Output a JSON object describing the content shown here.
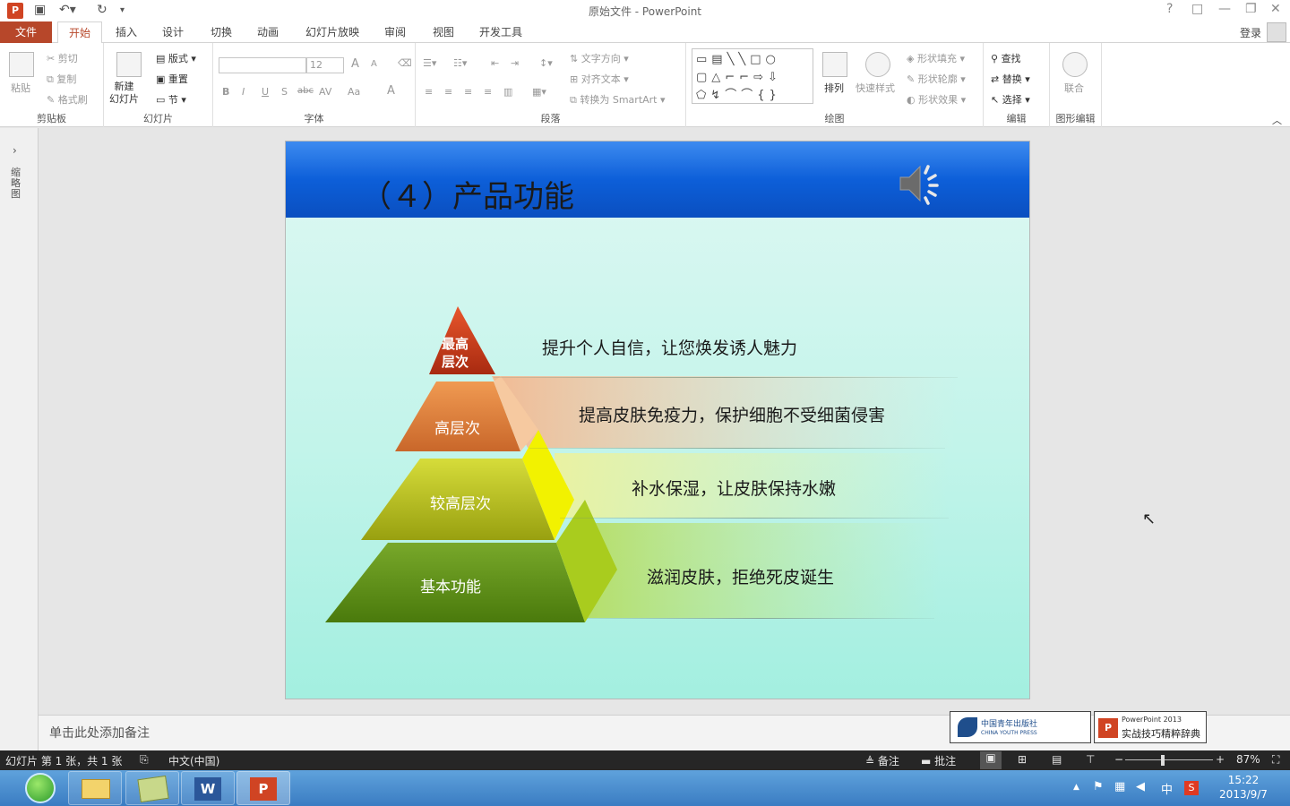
{
  "window": {
    "title": "原始文件 - PowerPoint",
    "app_icon": "P",
    "help": "?",
    "controls": [
      "□",
      "—",
      "❐",
      "✕"
    ]
  },
  "tabs": {
    "file": "文件",
    "items": [
      "开始",
      "插入",
      "设计",
      "切换",
      "动画",
      "幻灯片放映",
      "审阅",
      "视图",
      "开发工具"
    ],
    "login": "登录"
  },
  "ribbon": {
    "clipboard": {
      "label": "剪贴板",
      "paste": "粘贴",
      "cut": "剪切",
      "copy": "复制",
      "format_painter": "格式刷"
    },
    "slides": {
      "label": "幻灯片",
      "new_slide": "新建\n幻灯片",
      "layout": "版式",
      "reset": "重置",
      "section": "节"
    },
    "font": {
      "label": "字体",
      "font_name": "",
      "font_size": "12",
      "bold": "B",
      "italic": "I",
      "underline": "U",
      "shadow": "S",
      "strike": "abc",
      "spacing": "AV",
      "case": "Aa",
      "color": "A",
      "grow": "A",
      "shrink": "A"
    },
    "paragraph": {
      "label": "段落",
      "text_direction": "文字方向",
      "align_text": "对齐文本",
      "smartart": "转换为 SmartArt"
    },
    "drawing": {
      "label": "绘图",
      "arrange": "排列",
      "quick_styles": "快速样式",
      "shape_fill": "形状填充",
      "shape_outline": "形状轮廓",
      "shape_effects": "形状效果"
    },
    "editing": {
      "label": "编辑",
      "find": "查找",
      "replace": "替换",
      "select": "选择"
    },
    "shape_edit": {
      "label": "图形编辑",
      "merge": "联合"
    }
  },
  "left_pane": {
    "label": "缩略图"
  },
  "slide": {
    "title": "（４）产品功能",
    "levels": [
      {
        "tier": "最高\n层次",
        "text": "提升个人自信，让您焕发诱人魅力"
      },
      {
        "tier": "高层次",
        "text": "提高皮肤免疫力，保护细胞不受细菌侵害"
      },
      {
        "tier": "较高层次",
        "text": "补水保湿，让皮肤保持水嫩"
      },
      {
        "tier": "基本功能",
        "text": "滋润皮肤，拒绝死皮诞生"
      }
    ],
    "colors": {
      "header": "#0d5fd9",
      "tier1": "#c8381a",
      "tier2": "#e88a3a",
      "tier3": "#b9c61a",
      "tier4": "#5a8c12"
    }
  },
  "notes": {
    "placeholder": "单击此处添加备注"
  },
  "badges": {
    "publisher": "中国青年出版社",
    "publisher_en": "CHINA YOUTH PRESS",
    "book_line1": "PowerPoint 2013",
    "book_line2": "实战技巧精粹辞典"
  },
  "status": {
    "slide_info": "幻灯片 第 1 张，共 1 张",
    "language": "中文(中国)",
    "notes": "备注",
    "comments": "批注",
    "zoom": "87%"
  },
  "taskbar": {
    "time": "15:22",
    "date": "2013/9/7",
    "ime": "中",
    "tray_up": "▲"
  }
}
